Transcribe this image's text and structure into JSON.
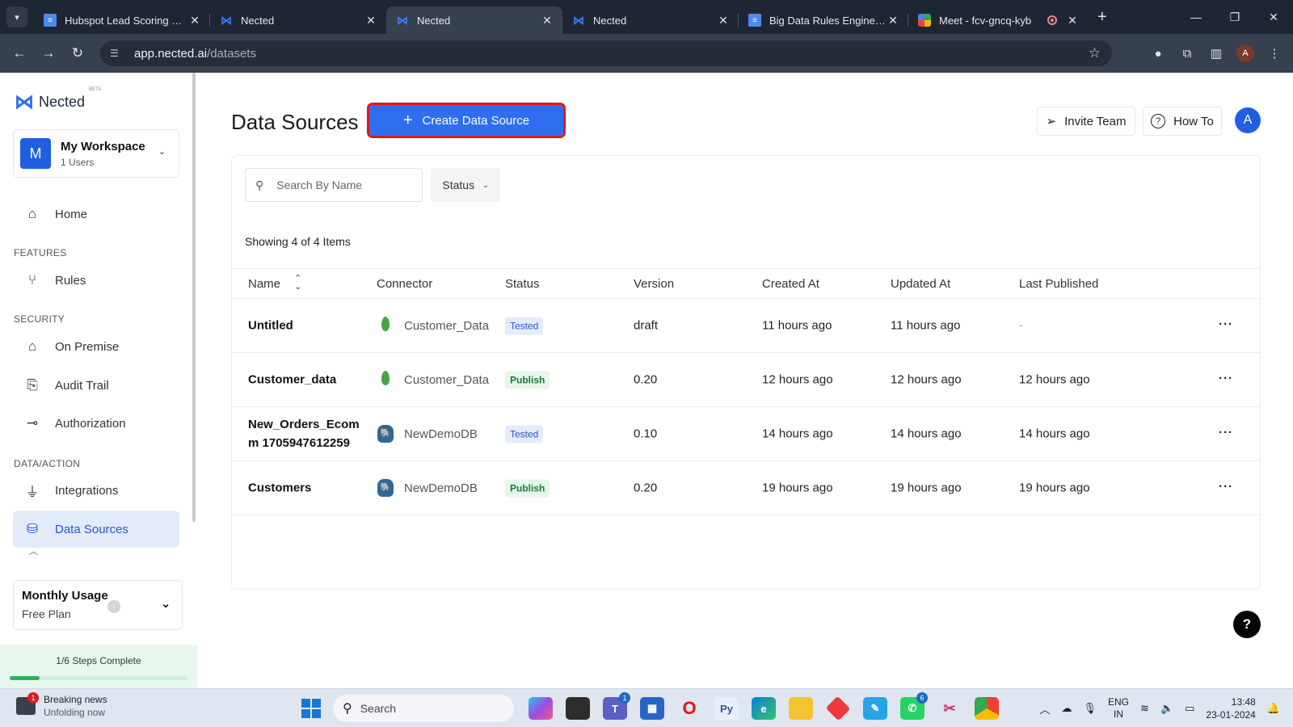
{
  "browser": {
    "tabs": [
      {
        "title": "Hubspot Lead Scoring Vs N",
        "favicon": "doc-icon",
        "active": false
      },
      {
        "title": "Nected",
        "favicon": "nected-icon",
        "active": false
      },
      {
        "title": "Nected",
        "favicon": "nected-icon",
        "active": true
      },
      {
        "title": "Nected",
        "favicon": "nected-icon",
        "active": false
      },
      {
        "title": "Big Data Rules Engine - Go",
        "favicon": "doc-icon",
        "active": false
      },
      {
        "title": "Meet - fcv-gncq-kyb",
        "favicon": "meet-icon",
        "active": false
      }
    ],
    "url_host": "app.nected.ai",
    "url_path": "/datasets",
    "account_initial": "A"
  },
  "sidebar": {
    "logo_text": "Nected",
    "logo_badge": "BETA",
    "workspace": {
      "initial": "M",
      "name": "My Workspace",
      "users": "1 Users"
    },
    "home_label": "Home",
    "sections": {
      "features": "FEATURES",
      "security": "SECURITY",
      "data_action": "DATA/ACTION"
    },
    "items": {
      "rules": "Rules",
      "on_premise": "On Premise",
      "audit_trail": "Audit Trail",
      "authorization": "Authorization",
      "integrations": "Integrations",
      "data_sources": "Data Sources"
    },
    "usage": {
      "title": "Monthly Usage",
      "plan": "Free Plan"
    },
    "steps": {
      "label": "1/6 Steps Complete",
      "progress": 0.1667
    }
  },
  "header": {
    "title": "Data Sources",
    "create_label": "Create Data Source",
    "invite_label": "Invite Team",
    "howto_label": "How To",
    "user_initial": "A"
  },
  "filters": {
    "search_placeholder": "Search By Name",
    "status_label": "Status"
  },
  "summary": "Showing 4 of 4 Items",
  "table": {
    "columns": [
      "Name",
      "Connector",
      "Status",
      "Version",
      "Created At",
      "Updated At",
      "Last Published"
    ],
    "rows": [
      {
        "name": "Untitled",
        "connector": "Customer_Data",
        "connector_icon": "mongodb-leaf-icon",
        "status": "Tested",
        "version": "draft",
        "created": "11 hours ago",
        "updated": "11 hours ago",
        "published": "-"
      },
      {
        "name": "Customer_data",
        "connector": "Customer_Data",
        "connector_icon": "mongodb-leaf-icon",
        "status": "Publish",
        "version": "0.20",
        "created": "12 hours ago",
        "updated": "12 hours ago",
        "published": "12 hours ago"
      },
      {
        "name": "New_Orders_Ecomm 1705947612259",
        "name_line1": "New_Orders_Ecom",
        "name_line2": "m 1705947612259",
        "connector": "NewDemoDB",
        "connector_icon": "postgres-icon",
        "status": "Tested",
        "version": "0.10",
        "created": "14 hours ago",
        "updated": "14 hours ago",
        "published": "14 hours ago"
      },
      {
        "name": "Customers",
        "connector": "NewDemoDB",
        "connector_icon": "postgres-icon",
        "status": "Publish",
        "version": "0.20",
        "created": "19 hours ago",
        "updated": "19 hours ago",
        "published": "19 hours ago"
      }
    ]
  },
  "help_label": "?",
  "taskbar": {
    "news_title": "Breaking news",
    "news_sub": "Unfolding now",
    "news_count": "1",
    "search_label": "Search",
    "teams_count": "1",
    "whatsapp_count": "6",
    "lang_1": "ENG",
    "lang_2": "IN",
    "time": "13:48",
    "date": "23-01-2024"
  },
  "colors": {
    "accent": "#2f6fef",
    "highlight_border": "#e0161b",
    "tested": "#2456d6",
    "publish": "#1b7a35"
  }
}
